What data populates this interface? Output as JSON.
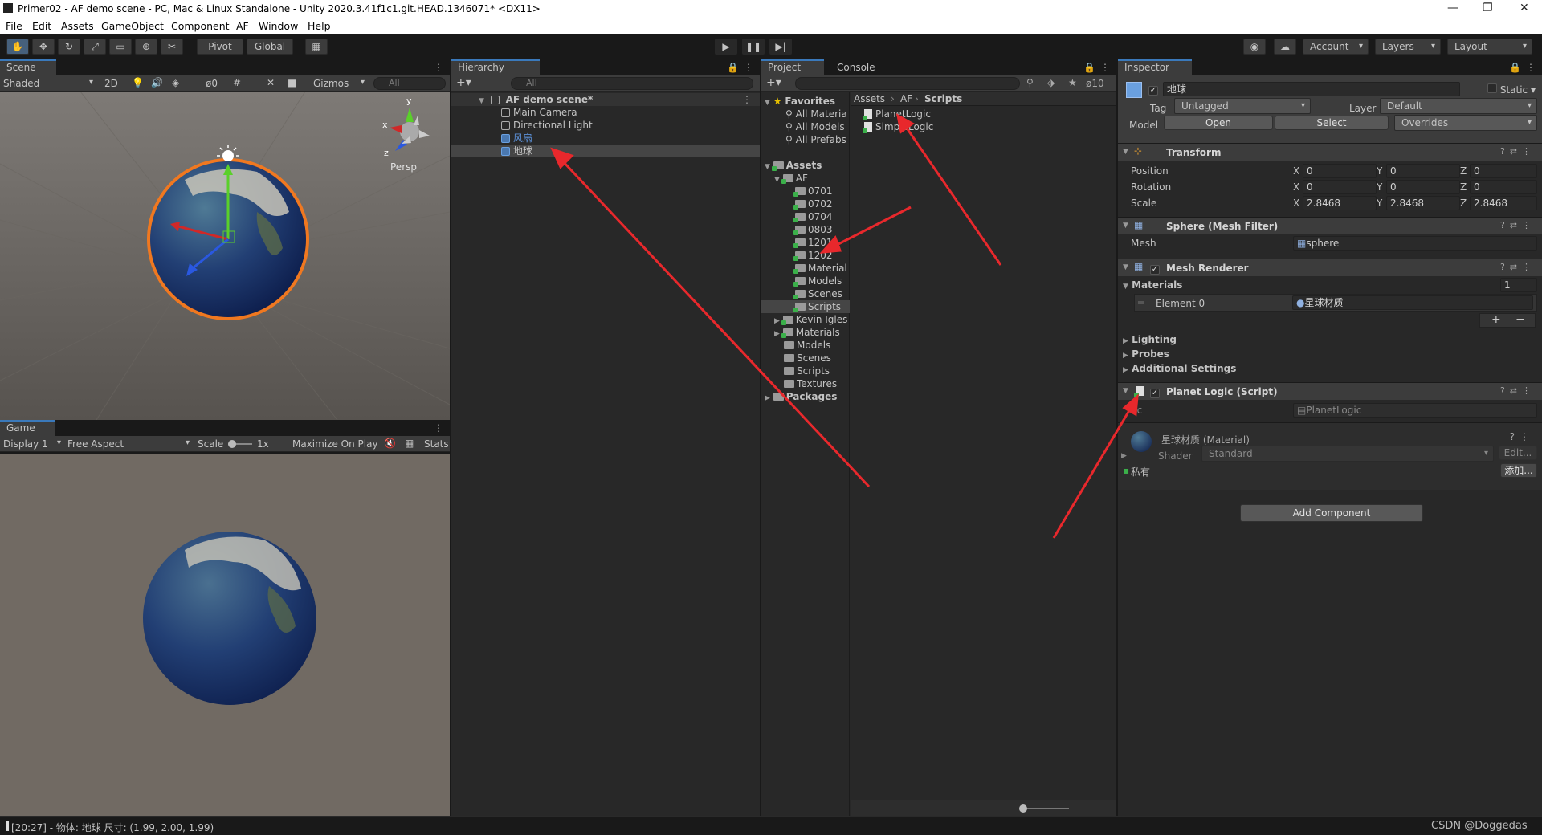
{
  "window": {
    "title": "Primer02 - AF demo scene - PC, Mac & Linux Standalone - Unity 2020.3.41f1c1.git.HEAD.1346071* <DX11>"
  },
  "menu": [
    "File",
    "Edit",
    "Assets",
    "GameObject",
    "Component",
    "AF",
    "Window",
    "Help"
  ],
  "toolbar": {
    "pivot": "Pivot",
    "global": "Global",
    "account": "Account",
    "layers": "Layers",
    "layout": "Layout"
  },
  "scene": {
    "tab": "Scene",
    "shading": "Shaded",
    "mode2d": "2D",
    "hidden_count": "0",
    "gizmos": "Gizmos",
    "search_placeholder": "All",
    "persp": "Persp",
    "axis_x": "x",
    "axis_y": "y",
    "axis_z": "z"
  },
  "game": {
    "tab": "Game",
    "display": "Display 1",
    "aspect": "Free Aspect",
    "scale_label": "Scale",
    "scale_value": "1x",
    "maximize": "Maximize On Play",
    "stats": "Stats"
  },
  "hierarchy": {
    "tab": "Hierarchy",
    "search_placeholder": "All",
    "scene_name": "AF demo scene*",
    "items": [
      "Main Camera",
      "Directional Light",
      "风扇",
      "地球"
    ]
  },
  "project": {
    "tab": "Project",
    "console_tab": "Console",
    "hidden_count": "10",
    "favorites": "Favorites",
    "favorite_items": [
      "All Materia",
      "All Models",
      "All Prefabs"
    ],
    "assets": "Assets",
    "af": "AF",
    "af_children": [
      "0701",
      "0702",
      "0704",
      "0803",
      "1201",
      "1202",
      "Material",
      "Models",
      "Scenes",
      "Scripts"
    ],
    "asset_children": [
      "Kevin Igles",
      "Materials",
      "Models",
      "Scenes",
      "Scripts",
      "Textures"
    ],
    "packages": "Packages",
    "breadcrumb": [
      "Assets",
      "AF",
      "Scripts"
    ],
    "files": [
      "PlanetLogic",
      "SimpleLogic"
    ]
  },
  "inspector": {
    "tab": "Inspector",
    "object_name": "地球",
    "static_label": "Static",
    "tag_label": "Tag",
    "tag_value": "Untagged",
    "layer_label": "Layer",
    "layer_value": "Default",
    "model_label": "Model",
    "open_btn": "Open",
    "select_btn": "Select",
    "overrides": "Overrides",
    "transform": {
      "title": "Transform",
      "position_label": "Position",
      "rotation_label": "Rotation",
      "scale_label": "Scale",
      "position": [
        "0",
        "0",
        "0"
      ],
      "rotation": [
        "0",
        "0",
        "0"
      ],
      "scale": [
        "2.8468",
        "2.8468",
        "2.8468"
      ],
      "x": "X",
      "y": "Y",
      "z": "Z"
    },
    "mesh_filter": {
      "title": "Sphere (Mesh Filter)",
      "mesh_label": "Mesh",
      "mesh_value": "sphere"
    },
    "mesh_renderer": {
      "title": "Mesh Renderer",
      "materials_label": "Materials",
      "materials_count": "1",
      "element0_label": "Element 0",
      "element0_value": "星球材质",
      "lighting": "Lighting",
      "probes": "Probes",
      "additional": "Additional Settings"
    },
    "script": {
      "title": "Planet Logic (Script)",
      "script_label": "Sc",
      "script_value": "PlanetLogic"
    },
    "material": {
      "title": "星球材质 (Material)",
      "shader_label": "Shader",
      "shader_value": "Standard",
      "edit_btn": "Edit...",
      "private_label": "私有",
      "add_btn": "添加..."
    },
    "add_component": "Add Component"
  },
  "status": {
    "text": "[20:27] - 物体: 地球  尺寸: (1.99, 2.00, 1.99)",
    "watermark": "CSDN @Doggedas"
  },
  "colors": {
    "accent": "#3a79bb",
    "arrow": "#e8282c",
    "selection_outline": "#f07820"
  }
}
